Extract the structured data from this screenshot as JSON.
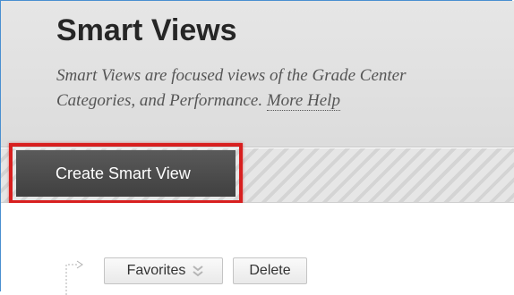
{
  "header": {
    "title": "Smart Views",
    "description": "Smart Views are focused views of the Grade Center",
    "description_line2": "Categories, and Performance. ",
    "more_help_label": "More Help"
  },
  "action_bar": {
    "create_label": "Create Smart View"
  },
  "list_toolbar": {
    "favorites_label": "Favorites",
    "delete_label": "Delete"
  },
  "colors": {
    "highlight_border": "#d81f1f",
    "button_dark": "#4a4a4a",
    "frame_border": "#4a8fd0"
  }
}
